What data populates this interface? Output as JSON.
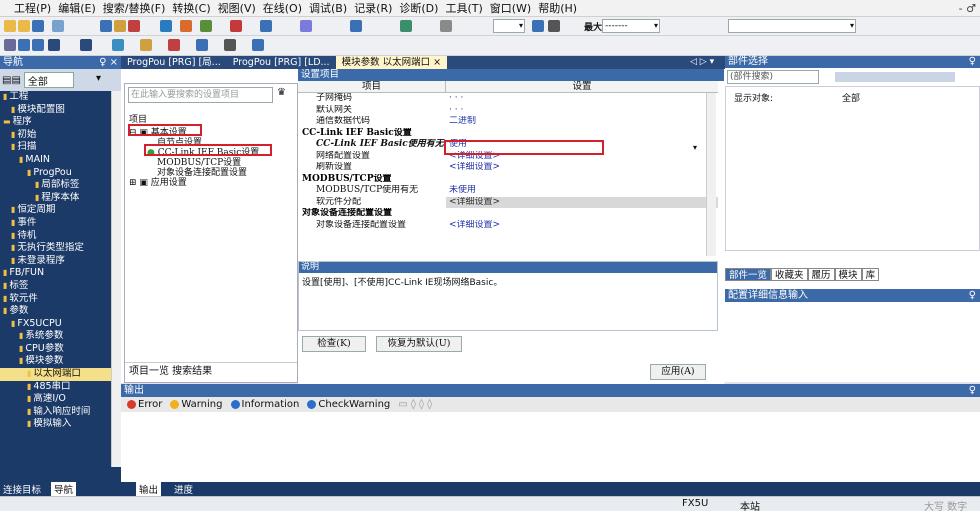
{
  "menu": [
    "工程(P)",
    "编辑(E)",
    "搜索/替换(F)",
    "转换(C)",
    "视图(V)",
    "在线(O)",
    "调试(B)",
    "记录(R)",
    "诊断(D)",
    "工具(T)",
    "窗口(W)",
    "帮助(H)"
  ],
  "window_ctl": "- ♂",
  "toolbar": {
    "max_label": "最大:",
    "max_value": "-------"
  },
  "nav": {
    "title": "导航",
    "pin": "♀ ×",
    "all_label": "全部",
    "items": [
      {
        "label": "工程",
        "icon": "▮",
        "indent": 0
      },
      {
        "label": "模块配置图",
        "icon": "▮",
        "indent": 1
      },
      {
        "label": "程序",
        "icon": "▬",
        "indent": 0
      },
      {
        "label": "初始",
        "icon": "▮",
        "indent": 1
      },
      {
        "label": "扫描",
        "icon": "▮",
        "indent": 1
      },
      {
        "label": "MAIN",
        "icon": "▮",
        "indent": 2
      },
      {
        "label": "ProgPou",
        "icon": "▮",
        "indent": 3
      },
      {
        "label": "局部标签",
        "icon": "▮",
        "indent": 4
      },
      {
        "label": "程序本体",
        "icon": "▮",
        "indent": 4
      },
      {
        "label": "恒定周期",
        "icon": "▮",
        "indent": 1
      },
      {
        "label": "事件",
        "icon": "▮",
        "indent": 1
      },
      {
        "label": "待机",
        "icon": "▮",
        "indent": 1
      },
      {
        "label": "无执行类型指定",
        "icon": "▮",
        "indent": 1
      },
      {
        "label": "未登录程序",
        "icon": "▮",
        "indent": 1
      },
      {
        "label": "FB/FUN",
        "icon": "▮",
        "indent": 0
      },
      {
        "label": "标签",
        "icon": "▮",
        "indent": 0
      },
      {
        "label": "软元件",
        "icon": "▮",
        "indent": 0
      },
      {
        "label": "参数",
        "icon": "▮",
        "indent": 0
      },
      {
        "label": "FX5UCPU",
        "icon": "▮",
        "indent": 1
      },
      {
        "label": "系统参数",
        "icon": "▮",
        "indent": 2
      },
      {
        "label": "CPU参数",
        "icon": "▮",
        "indent": 2
      },
      {
        "label": "模块参数",
        "icon": "▮",
        "indent": 2
      },
      {
        "label": "以太网端口",
        "icon": "▮",
        "indent": 3,
        "selected": true
      },
      {
        "label": "485串口",
        "icon": "▮",
        "indent": 3
      },
      {
        "label": "高速I/O",
        "icon": "▮",
        "indent": 3
      },
      {
        "label": "输入响应时间",
        "icon": "▮",
        "indent": 3
      },
      {
        "label": "模拟输入",
        "icon": "▮",
        "indent": 3
      }
    ]
  },
  "tabs": [
    {
      "label": "ProgPou [PRG] [局...",
      "active": false
    },
    {
      "label": "ProgPou [PRG] [LD...",
      "active": false
    },
    {
      "label": "模块参数 以太网端口 ×",
      "active": true
    }
  ],
  "tabs_ctl": "◁ ▷ ▾",
  "settings": {
    "header": "设置项目",
    "search_placeholder": "在此输入要搜索的设置项目",
    "search_icon": "♛",
    "tree_root": "项目",
    "tree": [
      {
        "label": "基本设置",
        "prefix": "⊟ ▣"
      },
      {
        "label": "自节点设置",
        "prefix": ""
      },
      {
        "label": "CC-Link IEF Basic设置",
        "prefix": "● "
      },
      {
        "label": "MODBUS/TCP设置",
        "prefix": ""
      },
      {
        "label": "对象设备连接配置设置",
        "prefix": ""
      },
      {
        "label": "应用设置",
        "prefix": "⊞ ▣"
      }
    ],
    "footer": "项目一览 搜索结果",
    "col_item": "项目",
    "col_setting": "设置",
    "rows": [
      {
        "k": "子网掩码",
        "v": "·  ·  ·",
        "grp": false
      },
      {
        "k": "默认网关",
        "v": "·  ·  ·",
        "grp": false
      },
      {
        "k": "通信数据代码",
        "v": "二进制",
        "grp": false
      },
      {
        "k": "CC-Link IEF Basic设置",
        "v": "",
        "grp": true
      },
      {
        "k": "CC-Link IEF Basic使用有无",
        "v": "使用",
        "grp": false,
        "bold": true
      },
      {
        "k": "网络配置设置",
        "v": "<详细设置>",
        "grp": false
      },
      {
        "k": "刷新设置",
        "v": "<详细设置>",
        "grp": false
      },
      {
        "k": "MODBUS/TCP设置",
        "v": "",
        "grp": true
      },
      {
        "k": "MODBUS/TCP使用有无",
        "v": "未使用",
        "grp": false
      },
      {
        "k": "软元件分配",
        "v": "<详细设置>",
        "grp": false,
        "gray": true
      },
      {
        "k": "对象设备连接配置设置",
        "v": "",
        "grp": true
      },
      {
        "k": "对象设备连接配置设置",
        "v": "<详细设置>",
        "grp": false
      }
    ],
    "desc_title": "说明",
    "desc_text": "设置[使用]、[不使用]CC-Link IE现场网络Basic。",
    "check_btn": "检查(K)",
    "default_btn": "恢复为默认(U)",
    "apply_btn": "应用(A)"
  },
  "parts": {
    "title": "部件选择",
    "pin": "♀",
    "search_placeholder": "(部件搜索)",
    "display_label": "显示对象:",
    "display_value": "全部",
    "tabs": [
      "部件一览",
      "收藏夹",
      "履历",
      "模块",
      "库"
    ],
    "detail_title": "配置详细信息输入",
    "detail_pin": "♀"
  },
  "output": {
    "title": "输出",
    "pin": "♀",
    "tabs": [
      {
        "label": "Error",
        "color": "#d93a2b"
      },
      {
        "label": "Warning",
        "color": "#f0b020"
      },
      {
        "label": "Information",
        "color": "#2a6fc9"
      },
      {
        "label": "CheckWarning",
        "color": "#2a6fc9"
      }
    ]
  },
  "bottom_tabs_left": [
    "连接目标",
    "导航"
  ],
  "bottom_tabs_right": [
    "输出",
    "进度"
  ],
  "status": {
    "cpu": "FX5U",
    "station": "本站",
    "right": "大写  数字"
  }
}
